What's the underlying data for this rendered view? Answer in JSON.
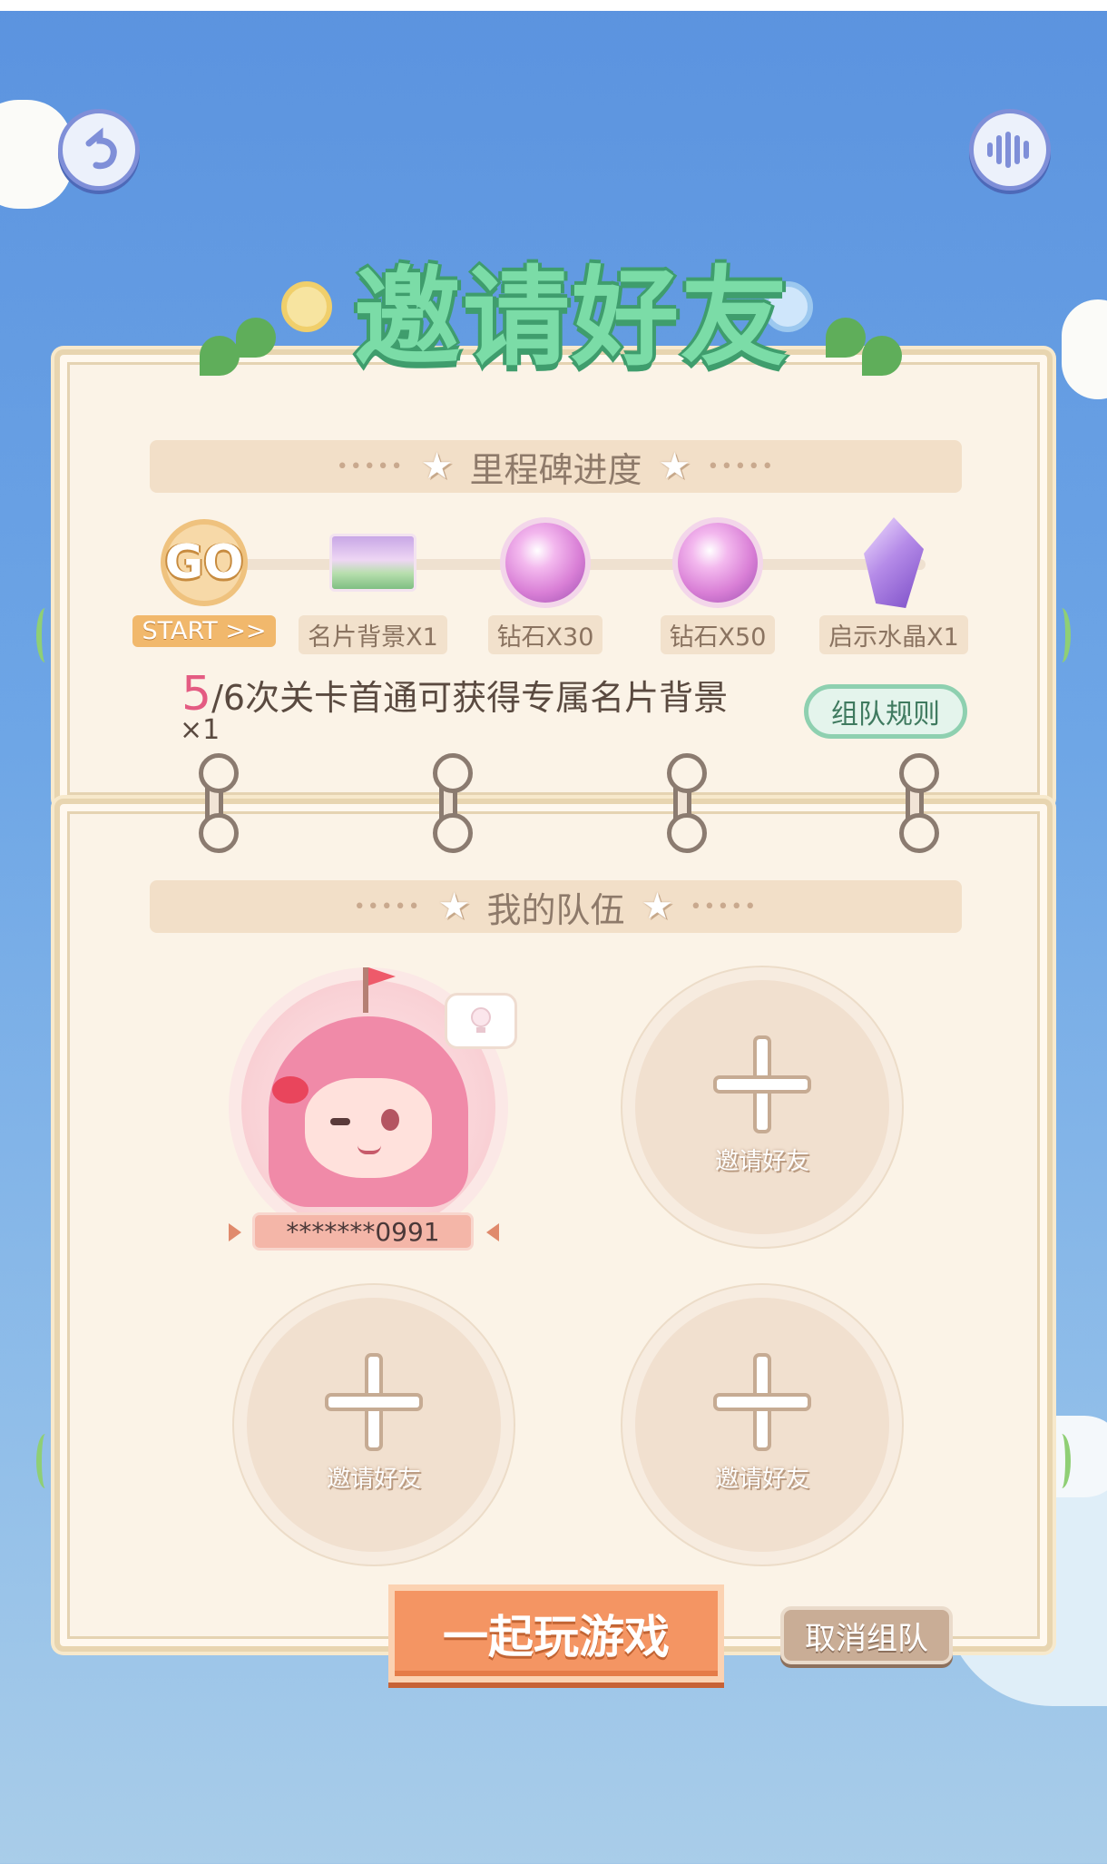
{
  "title": "邀请好友",
  "milestone": {
    "heading": "里程碑进度",
    "items": [
      {
        "label": "START >>",
        "icon": "go-badge-icon",
        "icon_text": "GO"
      },
      {
        "label": "名片背景X1",
        "icon": "name-card-background-icon"
      },
      {
        "label": "钻石X30",
        "icon": "diamond-icon"
      },
      {
        "label": "钻石X50",
        "icon": "diamond-icon"
      },
      {
        "label": "启示水晶X1",
        "icon": "crystal-icon"
      }
    ],
    "progress_current": "5",
    "progress_text": "/6次关卡首通可获得专属名片背景",
    "progress_suffix": "×1",
    "rules_button": "组队规则"
  },
  "team": {
    "heading": "我的队伍",
    "member_name": "*******0991",
    "invite_label": "邀请好友"
  },
  "actions": {
    "play_label": "一起玩游戏",
    "cancel_label": "取消组队"
  }
}
